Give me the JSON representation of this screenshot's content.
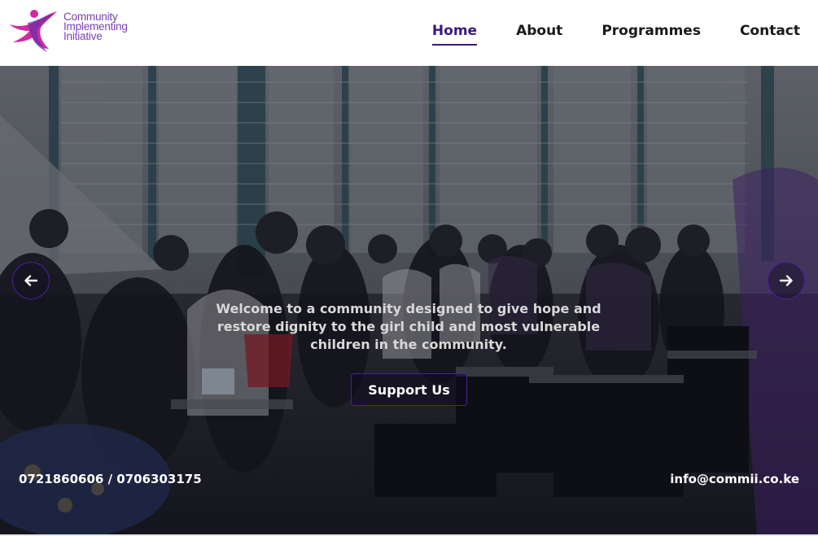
{
  "header": {
    "logo": {
      "line1": "Community",
      "line2": "Implementing",
      "line3": "Initiative",
      "icon": "dancing-figure-logo-icon"
    },
    "nav": [
      {
        "label": "Home",
        "active": true
      },
      {
        "label": "About",
        "active": false
      },
      {
        "label": "Programmes",
        "active": false
      },
      {
        "label": "Contact",
        "active": false
      }
    ]
  },
  "hero": {
    "tagline": "Welcome to a community designed to give hope and restore dignity to the girl child and most vulnerable children in the community.",
    "cta_label": "Support Us",
    "prev_icon": "arrow-left-icon",
    "next_icon": "arrow-right-icon"
  },
  "footer_bar": {
    "phone": "0721860606 / 0706303175",
    "email": "info@commii.co.ke"
  },
  "colors": {
    "brand_purple": "#3b1a7a",
    "logo_purple": "#7a3fb3",
    "logo_magenta": "#d02aa0"
  }
}
